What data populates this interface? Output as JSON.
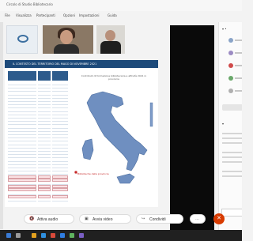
{
  "window": {
    "title": "Circolo di Studio Bibliotecario"
  },
  "menu": {
    "items": [
      "File",
      "Visualizza",
      "Partecipanti",
      "Opzioni",
      "Impostazioni",
      "Guida"
    ]
  },
  "slide": {
    "banner": "IL CONTESTO DEL TERRITORIO DEL MAGO DI NOVEMBRE 2021",
    "map_caption": "Contributi di formazione bibliotecaria e attività 2021 in provincia",
    "map_callout": "Biblioteche della provincia"
  },
  "controls": {
    "mic_label": "Attiva audio",
    "video_label": "Avvia video",
    "share_label": "Condividi"
  },
  "colors": {
    "accent": "#1d4a7a",
    "map_fill": "#6f8fc0",
    "end_call": "#d83b01",
    "highlight": "#fbe3e5"
  }
}
